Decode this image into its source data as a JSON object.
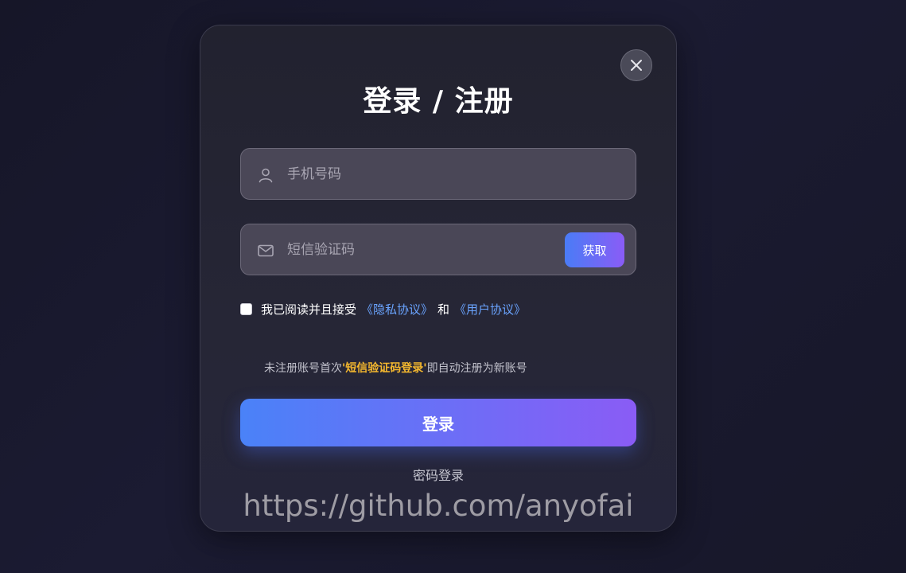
{
  "modal": {
    "title": "登录 / 注册",
    "close_icon": "close-icon"
  },
  "phone_field": {
    "placeholder": "手机号码",
    "icon": "user-icon"
  },
  "code_field": {
    "placeholder": "短信验证码",
    "icon": "mail-icon",
    "get_code_label": "获取"
  },
  "agreement": {
    "text": "我已阅读并且接受",
    "privacy_link": "《隐私协议》",
    "and_text": "和",
    "user_link": "《用户协议》",
    "checked": false
  },
  "notice": {
    "prefix": "未注册账号首次",
    "highlight": "'短信验证码登录'",
    "suffix": "即自动注册为新账号"
  },
  "login_button": "登录",
  "password_login_link": "密码登录",
  "watermark": "https://github.com/anyofai",
  "colors": {
    "accent_start": "#4a82f8",
    "accent_end": "#8a5cf5",
    "link": "#6aa4ff",
    "highlight": "#f5b82e"
  }
}
